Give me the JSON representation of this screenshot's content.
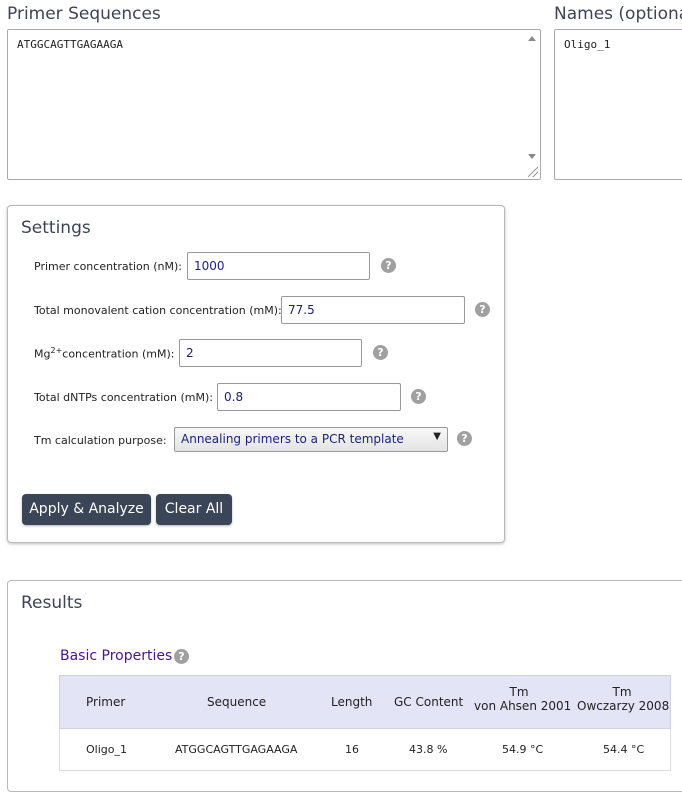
{
  "primer_sequences": {
    "label": "Primer Sequences",
    "value": "ATGGCAGTTGAGAAGA"
  },
  "names": {
    "label": "Names (optional",
    "value": "Oligo_1"
  },
  "settings": {
    "title": "Settings",
    "primer_conc_label": "Primer concentration (nM):",
    "primer_conc_value": "1000",
    "monovalent_label": "Total monovalent cation concentration (mM):",
    "monovalent_value": "77.5",
    "mg_label_prefix": "Mg",
    "mg_label_sup": "2+",
    "mg_label_suffix": "concentration (mM):",
    "mg_value": "2",
    "dntp_label": "Total dNTPs concentration (mM):",
    "dntp_value": "0.8",
    "tm_purpose_label": "Tm calculation purpose:",
    "tm_purpose_value": "Annealing primers to a PCR template",
    "help_glyph": "?",
    "select_caret": "▼",
    "apply_button": "Apply & Analyze",
    "clear_button": "Clear All"
  },
  "results": {
    "title": "Results",
    "basic_properties": "Basic Properties",
    "columns": {
      "primer": "Primer",
      "sequence": "Sequence",
      "length": "Length",
      "gc": "GC Content",
      "tm1_line1": "Tm",
      "tm1_line2": "von Ahsen 2001",
      "tm2_line1": "Tm",
      "tm2_line2": "Owczarzy 2008"
    },
    "rows": [
      {
        "primer": "Oligo_1",
        "sequence": "ATGGCAGTTGAGAAGA",
        "length": "16",
        "gc": "43.8 %",
        "tm1": "54.9 °C",
        "tm2": "54.4 °C"
      }
    ]
  },
  "icons": {
    "help": "help-icon",
    "scroll_up": "scroll-up-arrow-icon",
    "scroll_down": "scroll-down-arrow-icon",
    "resize": "resize-grip-icon",
    "caret": "chevron-down-icon"
  },
  "colors": {
    "button_bg": "#3b4558",
    "header_bg": "#e3e4f5",
    "link_color": "#4a148c",
    "input_text": "#1a237e"
  }
}
